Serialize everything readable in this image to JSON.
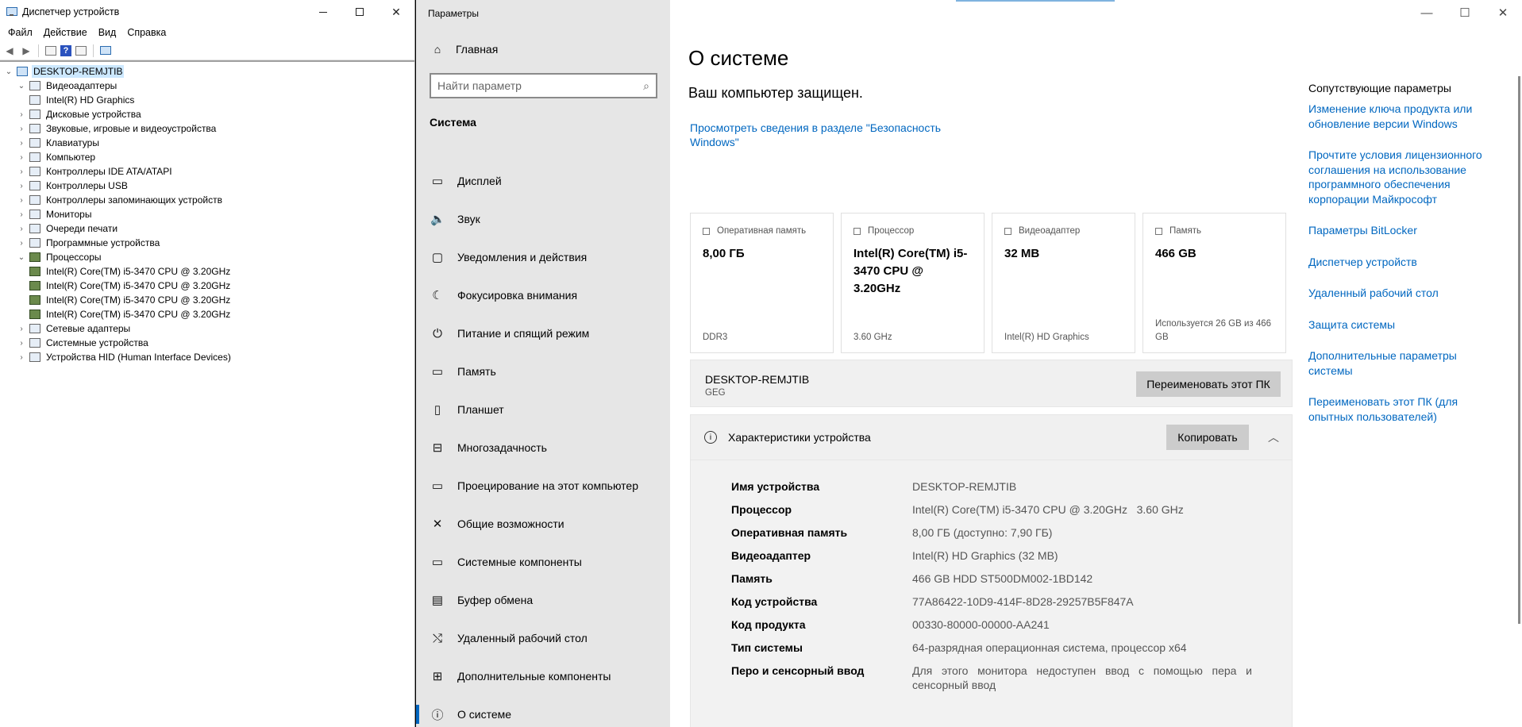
{
  "device_manager": {
    "title": "Диспетчер устройств",
    "menu": [
      "Файл",
      "Действие",
      "Вид",
      "Справка"
    ],
    "tree": [
      {
        "label": "DESKTOP-REMJTIB",
        "level": 0,
        "expander": "expanded",
        "icon": "computer-icon",
        "selected": true
      },
      {
        "label": "Видеоадаптеры",
        "level": 1,
        "expander": "expanded",
        "icon": "display-adapter-icon"
      },
      {
        "label": "Intel(R) HD Graphics",
        "level": 2,
        "expander": "none",
        "icon": "display-adapter-icon"
      },
      {
        "label": "Дисковые устройства",
        "level": 1,
        "expander": "collapsed",
        "icon": "disk-drive-icon"
      },
      {
        "label": "Звуковые, игровые и видеоустройства",
        "level": 1,
        "expander": "collapsed",
        "icon": "speaker-icon"
      },
      {
        "label": "Клавиатуры",
        "level": 1,
        "expander": "collapsed",
        "icon": "keyboard-icon"
      },
      {
        "label": "Компьютер",
        "level": 1,
        "expander": "collapsed",
        "icon": "computer-icon"
      },
      {
        "label": "Контроллеры IDE ATA/ATAPI",
        "level": 1,
        "expander": "collapsed",
        "icon": "ide-controller-icon"
      },
      {
        "label": "Контроллеры USB",
        "level": 1,
        "expander": "collapsed",
        "icon": "usb-icon"
      },
      {
        "label": "Контроллеры запоминающих устройств",
        "level": 1,
        "expander": "collapsed",
        "icon": "storage-controller-icon"
      },
      {
        "label": "Мониторы",
        "level": 1,
        "expander": "collapsed",
        "icon": "monitor-icon"
      },
      {
        "label": "Очереди печати",
        "level": 1,
        "expander": "collapsed",
        "icon": "printer-icon"
      },
      {
        "label": "Программные устройства",
        "level": 1,
        "expander": "collapsed",
        "icon": "software-device-icon"
      },
      {
        "label": "Процессоры",
        "level": 1,
        "expander": "expanded",
        "icon": "cpu-icon"
      },
      {
        "label": "Intel(R) Core(TM) i5-3470 CPU @ 3.20GHz",
        "level": 2,
        "expander": "none",
        "icon": "cpu-icon"
      },
      {
        "label": "Intel(R) Core(TM) i5-3470 CPU @ 3.20GHz",
        "level": 2,
        "expander": "none",
        "icon": "cpu-icon"
      },
      {
        "label": "Intel(R) Core(TM) i5-3470 CPU @ 3.20GHz",
        "level": 2,
        "expander": "none",
        "icon": "cpu-icon"
      },
      {
        "label": "Intel(R) Core(TM) i5-3470 CPU @ 3.20GHz",
        "level": 2,
        "expander": "none",
        "icon": "cpu-icon"
      },
      {
        "label": "Сетевые адаптеры",
        "level": 1,
        "expander": "collapsed",
        "icon": "network-adapter-icon"
      },
      {
        "label": "Системные устройства",
        "level": 1,
        "expander": "collapsed",
        "icon": "system-device-icon"
      },
      {
        "label": "Устройства HID (Human Interface Devices)",
        "level": 1,
        "expander": "collapsed",
        "icon": "hid-icon"
      }
    ]
  },
  "settings": {
    "app_title": "Параметры",
    "home_label": "Главная",
    "search_placeholder": "Найти параметр",
    "section": "Система",
    "nav": [
      {
        "label": "Дисплей",
        "icon": "display-icon",
        "glyph": "▭"
      },
      {
        "label": "Звук",
        "icon": "sound-icon",
        "glyph": "🔈"
      },
      {
        "label": "Уведомления и действия",
        "icon": "notifications-icon",
        "glyph": "▢"
      },
      {
        "label": "Фокусировка внимания",
        "icon": "moon-icon",
        "glyph": "☾"
      },
      {
        "label": "Питание и спящий режим",
        "icon": "power-icon",
        "glyph": "⏻"
      },
      {
        "label": "Память",
        "icon": "storage-icon",
        "glyph": "▭"
      },
      {
        "label": "Планшет",
        "icon": "tablet-icon",
        "glyph": "▯"
      },
      {
        "label": "Многозадачность",
        "icon": "multitasking-icon",
        "glyph": "⊟"
      },
      {
        "label": "Проецирование на этот компьютер",
        "icon": "projecting-icon",
        "glyph": "▭"
      },
      {
        "label": "Общие возможности",
        "icon": "shared-experiences-icon",
        "glyph": "✕"
      },
      {
        "label": "Системные компоненты",
        "icon": "components-icon",
        "glyph": "▭"
      },
      {
        "label": "Буфер обмена",
        "icon": "clipboard-icon",
        "glyph": "▤"
      },
      {
        "label": "Удаленный рабочий стол",
        "icon": "remote-desktop-icon",
        "glyph": "⤭"
      },
      {
        "label": "Дополнительные компоненты",
        "icon": "optional-features-icon",
        "glyph": "⊞"
      },
      {
        "label": "О системе",
        "icon": "info-icon",
        "glyph": "ⓘ",
        "active": true
      }
    ],
    "page_title": "О системе",
    "protected": "Ваш компьютер защищен.",
    "security_link": "Просмотреть сведения в разделе \"Безопасность Windows\"",
    "cards": [
      {
        "caption": "Оперативная память",
        "value": "8,00 ГБ",
        "sub": "DDR3",
        "icon": "ram-icon"
      },
      {
        "caption": "Процессор",
        "value": "Intel(R) Core(TM) i5-3470 CPU @ 3.20GHz",
        "sub": "3.60 GHz",
        "icon": "processor-icon"
      },
      {
        "caption": "Видеоадаптер",
        "value": "32 MB",
        "sub": "Intel(R) HD Graphics",
        "icon": "gpu-icon"
      },
      {
        "caption": "Память",
        "value": "466 GB",
        "sub": "Используется 26 GB из 466 GB",
        "icon": "disk-icon"
      }
    ],
    "pc_name": "DESKTOP-REMJTIB",
    "pc_group": "GEG",
    "rename_button": "Переименовать этот ПК",
    "specs_title": "Характеристики устройства",
    "copy_button": "Копировать",
    "specs": [
      {
        "k": "Имя устройства",
        "v": "DESKTOP-REMJTIB"
      },
      {
        "k": "Процессор",
        "v": "Intel(R) Core(TM) i5-3470 CPU @ 3.20GHz   3.60 GHz"
      },
      {
        "k": "Оперативная память",
        "v": "8,00 ГБ (доступно: 7,90 ГБ)"
      },
      {
        "k": "Видеоадаптер",
        "v": "Intel(R) HD Graphics (32 MB)"
      },
      {
        "k": "Память",
        "v": "466 GB HDD ST500DM002-1BD142"
      },
      {
        "k": "Код устройства",
        "v": "77A86422-10D9-414F-8D28-29257B5F847A"
      },
      {
        "k": "Код продукта",
        "v": "00330-80000-00000-AA241"
      },
      {
        "k": "Тип системы",
        "v": "64-разрядная операционная система, процессор x64"
      },
      {
        "k": "Перо и сенсорный ввод",
        "v": "Для этого монитора недоступен ввод с помощью пера и сенсорный ввод"
      }
    ],
    "related_title": "Сопутствующие параметры",
    "related_links": [
      "Изменение ключа продукта или обновление версии Windows",
      "Прочтите условия лицензионного соглашения на использование программного обеспечения корпорации Майкрософт",
      "Параметры BitLocker",
      "Диспетчер устройств",
      "Удаленный рабочий стол",
      "Защита системы",
      "Дополнительные параметры системы",
      "Переименовать этот ПК (для опытных пользователей)"
    ],
    "accent_color": "#0067c0"
  }
}
